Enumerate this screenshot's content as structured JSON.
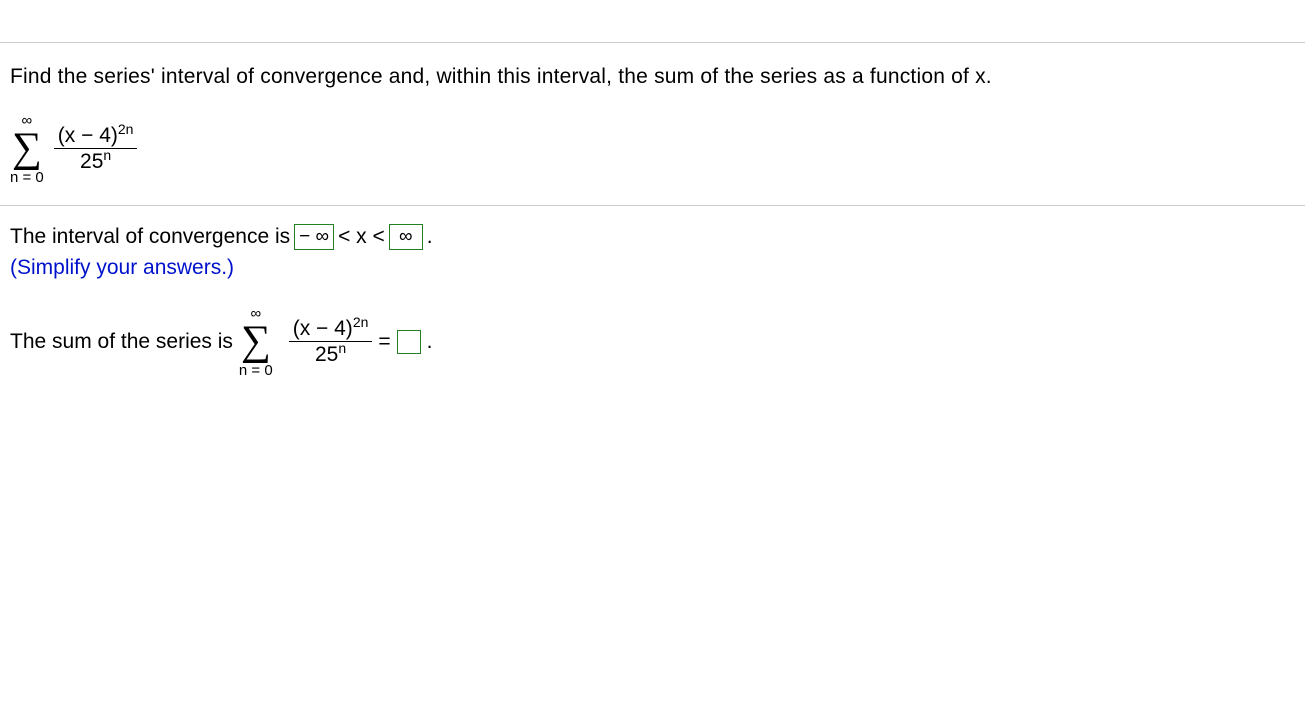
{
  "question": {
    "text": "Find the series' interval of convergence and, within this interval, the sum of the series as a function of x.",
    "sigma_top": "∞",
    "sigma_bottom": "n = 0",
    "numerator_base": "(x − 4)",
    "numerator_exp": "2n",
    "denominator_base": "25",
    "denominator_exp": "n"
  },
  "part1": {
    "label": "The interval of convergence is",
    "lower_value": "− ∞",
    "middle": "< x <",
    "upper_value": "∞",
    "period": ".",
    "hint": "(Simplify your answers.)"
  },
  "part2": {
    "label": "The sum of the series is",
    "sigma_top": "∞",
    "sigma_bottom": "n = 0",
    "numerator_base": "(x − 4)",
    "numerator_exp": "2n",
    "denominator_base": "25",
    "denominator_exp": "n",
    "equals": " = ",
    "period": "."
  }
}
